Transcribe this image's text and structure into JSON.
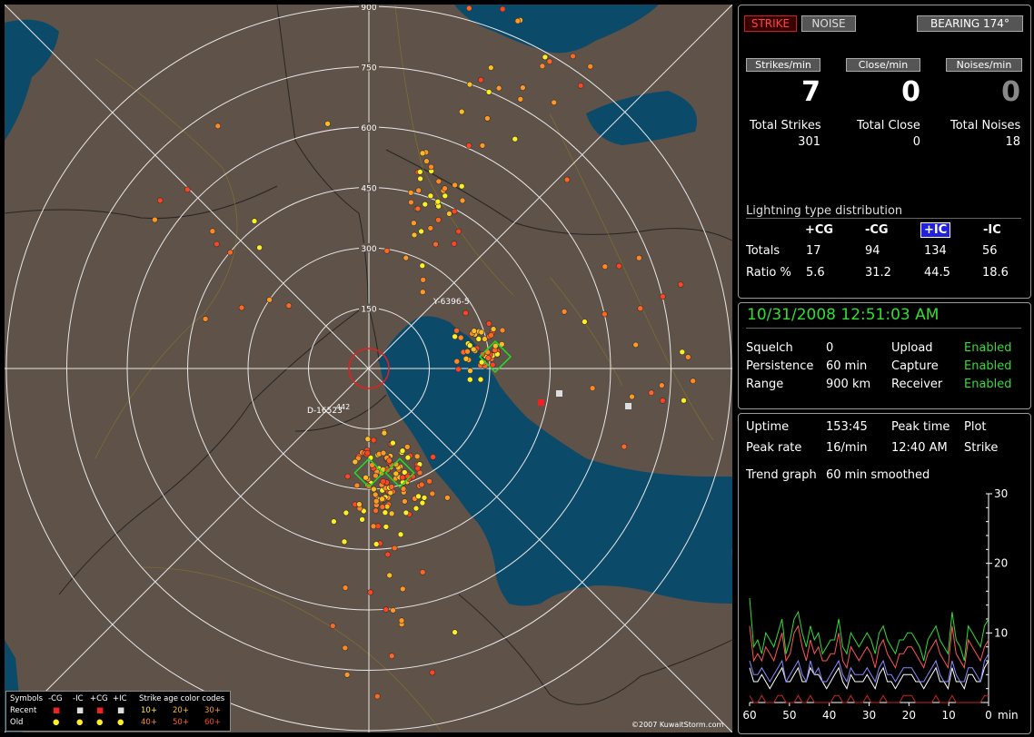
{
  "map": {
    "range_labels": [
      "150",
      "300",
      "450",
      "600",
      "750",
      "900"
    ],
    "station_labels": [
      "Y-6396-5",
      "D-16523",
      "-442"
    ],
    "copyright": "©2007 KuwaitStorm.com",
    "legend": {
      "symbols_title": "Symbols",
      "cols": [
        "-CG",
        "-IC",
        "+CG",
        "+IC"
      ],
      "recent": "Recent",
      "old": "Old",
      "age_title": "Strike age color codes",
      "age_recent": [
        "10+",
        "20+",
        "30+"
      ],
      "age_old": [
        "40+",
        "50+",
        "60+"
      ]
    }
  },
  "header": {
    "strike_btn": "STRIKE",
    "noise_btn": "NOISE",
    "bearing": "BEARING 174°"
  },
  "counts": {
    "strikes_min_label": "Strikes/min",
    "close_min_label": "Close/min",
    "noises_min_label": "Noises/min",
    "strikes_min": "7",
    "close_min": "0",
    "noises_min": "0",
    "total_strikes_label": "Total Strikes",
    "total_close_label": "Total Close",
    "total_noises_label": "Total Noises",
    "total_strikes": "301",
    "total_close": "0",
    "total_noises": "18"
  },
  "distribution": {
    "title": "Lightning type distribution",
    "types": [
      "+CG",
      "-CG",
      "+IC",
      "-IC"
    ],
    "totals_label": "Totals",
    "ratio_label": "Ratio %",
    "totals": [
      "17",
      "94",
      "134",
      "56"
    ],
    "ratios": [
      "5.6",
      "31.2",
      "44.5",
      "18.6"
    ]
  },
  "status": {
    "datetime": "10/31/2008 12:51:03 AM",
    "squelch_label": "Squelch",
    "squelch": "0",
    "persistence_label": "Persistence",
    "persistence": "60 min",
    "range_label": "Range",
    "range": "900 km",
    "upload_label": "Upload",
    "upload": "Enabled",
    "capture_label": "Capture",
    "capture": "Enabled",
    "receiver_label": "Receiver",
    "receiver": "Enabled"
  },
  "stats": {
    "uptime_label": "Uptime",
    "uptime": "153:45",
    "peak_time_label": "Peak time",
    "peak_time": "12:40 AM",
    "plot_label": "Plot",
    "plot": "Strike",
    "peak_rate_label": "Peak rate",
    "peak_rate": "16/min",
    "trend_label": "Trend graph",
    "trend": "60 min smoothed"
  },
  "chart_data": {
    "type": "line",
    "x_ticks": [
      "60",
      "50",
      "40",
      "30",
      "20",
      "10",
      "0"
    ],
    "x_unit": "min",
    "y_ticks": [
      "30",
      "20",
      "10"
    ],
    "ylim": [
      0,
      30
    ],
    "series": [
      {
        "color": "#33dd33",
        "values": [
          15,
          8,
          9,
          7,
          10,
          9,
          8,
          10,
          12,
          7,
          9,
          12,
          13,
          10,
          8,
          11,
          9,
          10,
          7,
          8,
          9,
          9,
          12,
          8,
          7,
          10,
          9,
          8,
          9,
          10,
          9,
          7,
          10,
          11,
          9,
          8,
          7,
          9,
          9,
          10,
          10,
          9,
          8,
          6,
          9,
          10,
          11,
          9,
          8,
          7,
          13,
          9,
          8,
          6,
          11,
          10,
          9,
          8,
          11,
          12
        ]
      },
      {
        "color": "#ff5555",
        "values": [
          11,
          6,
          7,
          6,
          8,
          7,
          6,
          8,
          10,
          6,
          7,
          10,
          11,
          8,
          6,
          9,
          7,
          8,
          6,
          6,
          7,
          7,
          10,
          6,
          5,
          8,
          7,
          6,
          7,
          8,
          7,
          5,
          8,
          9,
          7,
          6,
          5,
          7,
          7,
          8,
          8,
          7,
          6,
          5,
          7,
          8,
          9,
          7,
          6,
          5,
          11,
          7,
          6,
          5,
          9,
          8,
          7,
          6,
          8,
          9
        ]
      },
      {
        "color": "#ffffff",
        "values": [
          5,
          3,
          3,
          4,
          3,
          2,
          3,
          4,
          5,
          3,
          3,
          4,
          5,
          3,
          3,
          5,
          4,
          4,
          3,
          2,
          3,
          4,
          5,
          3,
          2,
          4,
          3,
          3,
          3,
          4,
          3,
          2,
          4,
          5,
          3,
          3,
          2,
          3,
          4,
          4,
          4,
          3,
          3,
          2,
          3,
          4,
          5,
          3,
          3,
          2,
          5,
          3,
          3,
          2,
          4,
          4,
          3,
          3,
          5,
          6
        ]
      },
      {
        "color": "#8888ff",
        "values": [
          6,
          4,
          4,
          5,
          4,
          3,
          4,
          5,
          6,
          3,
          4,
          5,
          6,
          4,
          3,
          6,
          4,
          5,
          3,
          3,
          4,
          5,
          6,
          4,
          3,
          5,
          4,
          4,
          4,
          5,
          4,
          3,
          5,
          6,
          4,
          4,
          3,
          4,
          5,
          5,
          5,
          4,
          3,
          3,
          4,
          5,
          6,
          4,
          3,
          3,
          6,
          4,
          3,
          3,
          5,
          5,
          4,
          3,
          6,
          7
        ]
      },
      {
        "color": "#cc2222",
        "values": [
          1,
          0,
          0,
          1,
          0,
          0,
          0,
          1,
          1,
          0,
          0,
          0,
          1,
          0,
          0,
          1,
          0,
          0,
          0,
          0,
          0,
          1,
          1,
          0,
          0,
          1,
          0,
          0,
          0,
          1,
          0,
          0,
          0,
          1,
          0,
          0,
          0,
          0,
          1,
          1,
          1,
          0,
          0,
          0,
          0,
          0,
          1,
          0,
          0,
          0,
          1,
          0,
          0,
          0,
          0,
          0,
          0,
          0,
          1,
          1
        ]
      }
    ]
  }
}
